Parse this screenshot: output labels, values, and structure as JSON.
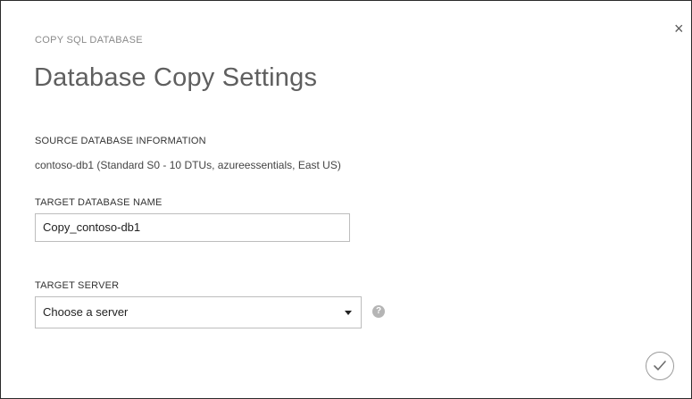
{
  "dialog": {
    "close_glyph": "×",
    "subtitle": "COPY SQL DATABASE",
    "title": "Database Copy Settings"
  },
  "source": {
    "label": "SOURCE DATABASE INFORMATION",
    "info": "contoso-db1 (Standard S0 - 10 DTUs, azureessentials, East US)"
  },
  "target_name": {
    "label": "TARGET DATABASE NAME",
    "value": "Copy_contoso-db1"
  },
  "target_server": {
    "label": "TARGET SERVER",
    "selected": "Choose a server"
  },
  "help": {
    "glyph": "?"
  },
  "icons": {
    "close": "close-icon",
    "dropdown": "chevron-down-icon",
    "help": "help-icon",
    "confirm": "checkmark-icon"
  }
}
